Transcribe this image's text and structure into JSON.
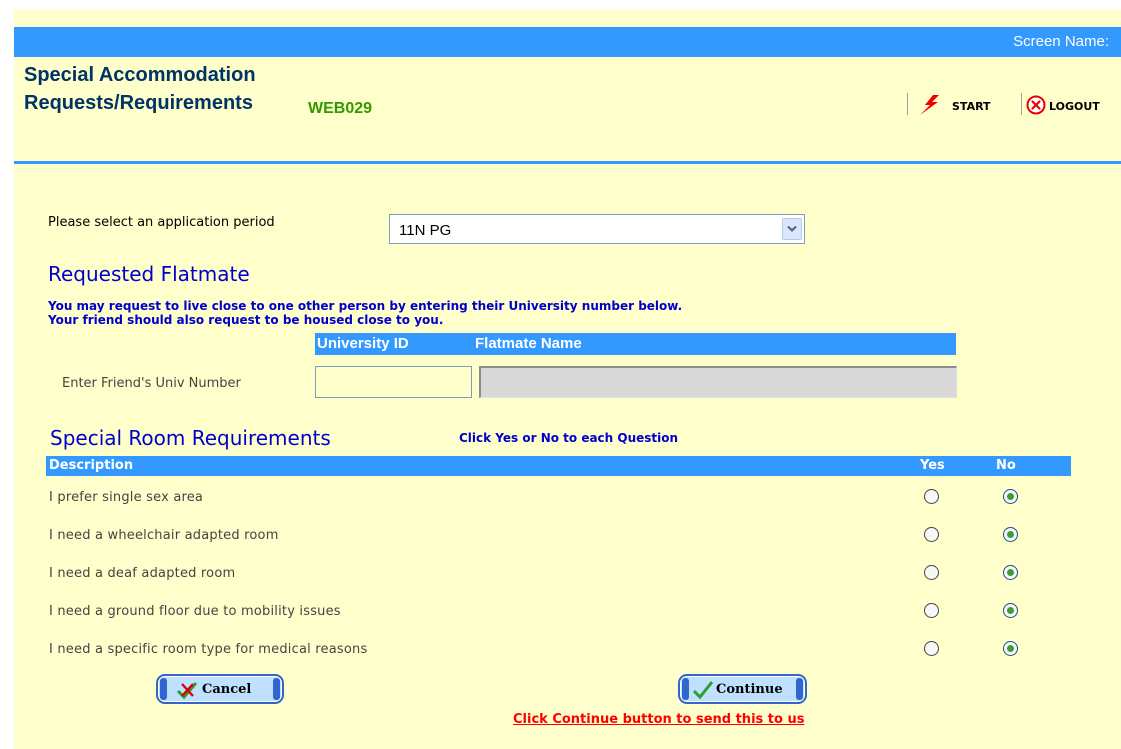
{
  "header": {
    "screen_name_label": "Screen Name:",
    "page_title": "Special Accommodation Requests/Requirements",
    "screen_code": "WEB029",
    "start_label": "START",
    "logout_label": "LOGOUT",
    "icons": {
      "start": "lightning-bolt-icon",
      "logout": "circle-x-icon"
    }
  },
  "period": {
    "label": "Please select an application period",
    "selected_value": "11N PG"
  },
  "flatmate": {
    "heading": "Requested Flatmate",
    "notice_line1": "You may request to live close to one other person by entering their University number below.",
    "notice_line2": "Your friend should also request to be housed close to you.",
    "col_university_id": "University ID",
    "col_flatmate_name": "Flatmate Name",
    "friend_label": "Enter Friend's Univ Number",
    "friend_value": "",
    "flatmate_name_value": ""
  },
  "requirements": {
    "heading": "Special Room Requirements",
    "instruction": "Click Yes or No to each Question",
    "col_description": "Description",
    "col_yes": "Yes",
    "col_no": "No",
    "rows": [
      {
        "description": "I prefer single sex area",
        "answer": "No"
      },
      {
        "description": "I need a wheelchair adapted room",
        "answer": "No"
      },
      {
        "description": "I need a deaf adapted room",
        "answer": "No"
      },
      {
        "description": "I need a ground floor due to mobility issues",
        "answer": "No"
      },
      {
        "description": "I need a specific room type for medical reasons",
        "answer": "No"
      }
    ]
  },
  "actions": {
    "cancel_label": "Cancel",
    "continue_label": "Continue",
    "footer_link": "Click Continue button to send this to us"
  },
  "colors": {
    "background": "#ffffcc",
    "header_bar": "#3399ff",
    "heading_blue": "#0000cc",
    "code_green": "#339900",
    "footer_red": "#ff0000",
    "radio_checked": "#3f9b3a"
  }
}
